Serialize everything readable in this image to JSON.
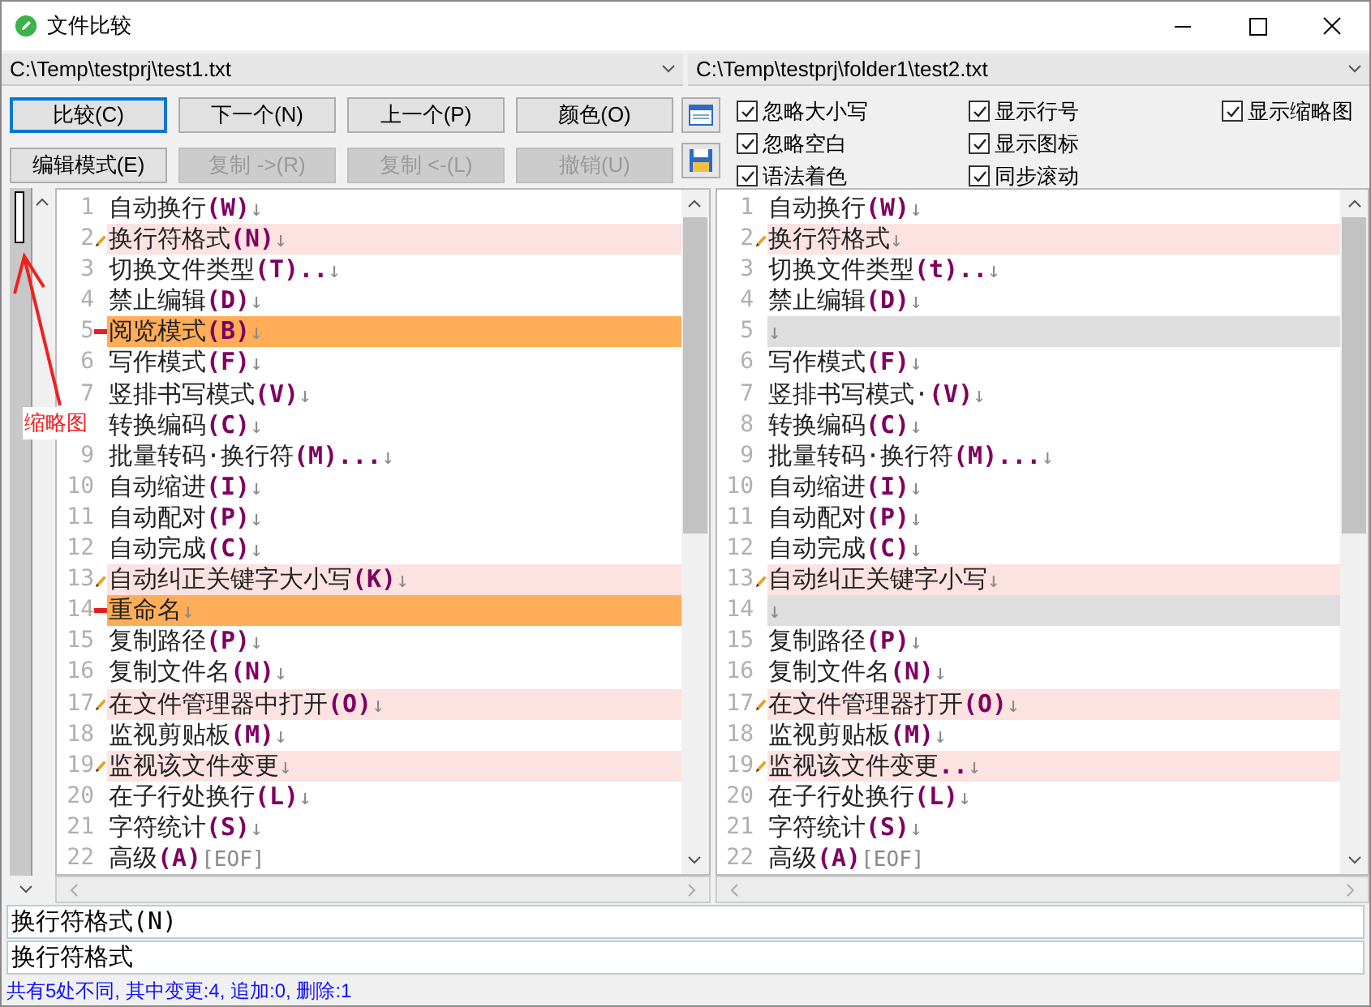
{
  "window": {
    "title": "文件比较"
  },
  "paths": [
    "C:\\Temp\\testprj\\test1.txt",
    "C:\\Temp\\testprj\\folder1\\test2.txt"
  ],
  "buttons": [
    {
      "label": "比较(C)",
      "disabled": false,
      "focused": true
    },
    {
      "label": "下一个(N)",
      "disabled": false,
      "focused": false
    },
    {
      "label": "上一个(P)",
      "disabled": false,
      "focused": false
    },
    {
      "label": "颜色(O)",
      "disabled": false,
      "focused": false
    },
    {
      "label": "编辑模式(E)",
      "disabled": false,
      "focused": false
    },
    {
      "label": "复制 ->(R)",
      "disabled": true,
      "focused": false
    },
    {
      "label": "复制 <-(L)",
      "disabled": true,
      "focused": false
    },
    {
      "label": "撤销(U)",
      "disabled": true,
      "focused": false
    }
  ],
  "options": [
    {
      "label": "忽略大小写",
      "checked": true
    },
    {
      "label": "忽略空白",
      "checked": true
    },
    {
      "label": "语法着色",
      "checked": true
    },
    {
      "label": "显示行号",
      "checked": true
    },
    {
      "label": "显示图标",
      "checked": true
    },
    {
      "label": "同步滚动",
      "checked": true
    },
    {
      "label": "显示缩略图",
      "checked": true
    }
  ],
  "annotation": {
    "label": "缩略图"
  },
  "panes": [
    {
      "lines": [
        {
          "number": "1",
          "kind": "same",
          "segments": [
            {
              "kind": "text",
              "text": "自动换行"
            },
            {
              "kind": "key",
              "text": "(W)"
            },
            {
              "kind": "mark",
              "text": "↓"
            }
          ]
        },
        {
          "number": "2",
          "kind": "changed",
          "segments": [
            {
              "kind": "text",
              "text": "换行符格式"
            },
            {
              "kind": "key",
              "text": "(N)"
            },
            {
              "kind": "mark",
              "text": "↓"
            }
          ]
        },
        {
          "number": "3",
          "kind": "same",
          "segments": [
            {
              "kind": "text",
              "text": "切换文件类型"
            },
            {
              "kind": "key",
              "text": "(T).."
            },
            {
              "kind": "mark",
              "text": "↓"
            }
          ]
        },
        {
          "number": "4",
          "kind": "same",
          "segments": [
            {
              "kind": "text",
              "text": "禁止编辑"
            },
            {
              "kind": "key",
              "text": "(D)"
            },
            {
              "kind": "mark",
              "text": "↓"
            }
          ]
        },
        {
          "number": "5",
          "kind": "removed",
          "segments": [
            {
              "kind": "text",
              "text": "阅览模式"
            },
            {
              "kind": "key",
              "text": "(B)"
            },
            {
              "kind": "mark",
              "text": "↓"
            }
          ]
        },
        {
          "number": "6",
          "kind": "same",
          "segments": [
            {
              "kind": "text",
              "text": "写作模式"
            },
            {
              "kind": "key",
              "text": "(F)"
            },
            {
              "kind": "mark",
              "text": "↓"
            }
          ]
        },
        {
          "number": "7",
          "kind": "same",
          "segments": [
            {
              "kind": "text",
              "text": "竖排书写模式"
            },
            {
              "kind": "key",
              "text": "(V)"
            },
            {
              "kind": "mark",
              "text": "↓"
            }
          ]
        },
        {
          "kind": "same",
          "segments": [
            {
              "kind": "text",
              "text": "转换编码"
            },
            {
              "kind": "key",
              "text": "(C)"
            },
            {
              "kind": "mark",
              "text": "↓"
            }
          ]
        },
        {
          "number": "9",
          "kind": "same",
          "segments": [
            {
              "kind": "text",
              "text": "批量转码·换行符"
            },
            {
              "kind": "key",
              "text": "(M)..."
            },
            {
              "kind": "mark",
              "text": "↓"
            }
          ]
        },
        {
          "number": "10",
          "kind": "same",
          "segments": [
            {
              "kind": "text",
              "text": "自动缩进"
            },
            {
              "kind": "key",
              "text": "(I)"
            },
            {
              "kind": "mark",
              "text": "↓"
            }
          ]
        },
        {
          "number": "11",
          "kind": "same",
          "segments": [
            {
              "kind": "text",
              "text": "自动配对"
            },
            {
              "kind": "key",
              "text": "(P)"
            },
            {
              "kind": "mark",
              "text": "↓"
            }
          ]
        },
        {
          "number": "12",
          "kind": "same",
          "segments": [
            {
              "kind": "text",
              "text": "自动完成"
            },
            {
              "kind": "key",
              "text": "(C)"
            },
            {
              "kind": "mark",
              "text": "↓"
            }
          ]
        },
        {
          "number": "13",
          "kind": "changed",
          "segments": [
            {
              "kind": "text",
              "text": "自动纠正关键字大小写"
            },
            {
              "kind": "key",
              "text": "(K)"
            },
            {
              "kind": "mark",
              "text": "↓"
            }
          ]
        },
        {
          "number": "14",
          "kind": "removed",
          "segments": [
            {
              "kind": "text",
              "text": "重命名"
            },
            {
              "kind": "mark",
              "text": "↓"
            }
          ]
        },
        {
          "number": "15",
          "kind": "same",
          "segments": [
            {
              "kind": "text",
              "text": "复制路径"
            },
            {
              "kind": "key",
              "text": "(P)"
            },
            {
              "kind": "mark",
              "text": "↓"
            }
          ]
        },
        {
          "number": "16",
          "kind": "same",
          "segments": [
            {
              "kind": "text",
              "text": "复制文件名"
            },
            {
              "kind": "key",
              "text": "(N)"
            },
            {
              "kind": "mark",
              "text": "↓"
            }
          ]
        },
        {
          "number": "17",
          "kind": "changed",
          "segments": [
            {
              "kind": "text",
              "text": "在文件管理器中打开"
            },
            {
              "kind": "key",
              "text": "(O)"
            },
            {
              "kind": "mark",
              "text": "↓"
            }
          ]
        },
        {
          "number": "18",
          "kind": "same",
          "segments": [
            {
              "kind": "text",
              "text": "监视剪贴板"
            },
            {
              "kind": "key",
              "text": "(M)"
            },
            {
              "kind": "mark",
              "text": "↓"
            }
          ]
        },
        {
          "number": "19",
          "kind": "changed",
          "segments": [
            {
              "kind": "text",
              "text": "监视该文件变更"
            },
            {
              "kind": "mark",
              "text": "↓"
            }
          ]
        },
        {
          "number": "20",
          "kind": "same",
          "segments": [
            {
              "kind": "text",
              "text": "在子行处换行"
            },
            {
              "kind": "key",
              "text": "(L)"
            },
            {
              "kind": "mark",
              "text": "↓"
            }
          ]
        },
        {
          "number": "21",
          "kind": "same",
          "segments": [
            {
              "kind": "text",
              "text": "字符统计"
            },
            {
              "kind": "key",
              "text": "(S)"
            },
            {
              "kind": "mark",
              "text": "↓"
            }
          ]
        },
        {
          "number": "22",
          "kind": "same",
          "segments": [
            {
              "kind": "text",
              "text": "高级"
            },
            {
              "kind": "key",
              "text": "(A)"
            },
            {
              "kind": "mark",
              "text": "[EOF]"
            }
          ]
        }
      ]
    },
    {
      "lines": [
        {
          "number": "1",
          "kind": "same",
          "segments": [
            {
              "kind": "text",
              "text": "自动换行"
            },
            {
              "kind": "key",
              "text": "(W)"
            },
            {
              "kind": "mark",
              "text": "↓"
            }
          ]
        },
        {
          "number": "2",
          "kind": "changed",
          "segments": [
            {
              "kind": "text",
              "text": "换行符格式"
            },
            {
              "kind": "mark",
              "text": "↓"
            }
          ]
        },
        {
          "number": "3",
          "kind": "same",
          "segments": [
            {
              "kind": "text",
              "text": "切换文件类型"
            },
            {
              "kind": "key",
              "text": "(t).."
            },
            {
              "kind": "mark",
              "text": "↓"
            }
          ]
        },
        {
          "number": "4",
          "kind": "same",
          "segments": [
            {
              "kind": "text",
              "text": "禁止编辑"
            },
            {
              "kind": "key",
              "text": "(D)"
            },
            {
              "kind": "mark",
              "text": "↓"
            }
          ]
        },
        {
          "number": "5",
          "kind": "empty",
          "segments": [
            {
              "kind": "mark",
              "text": "↓"
            }
          ]
        },
        {
          "number": "6",
          "kind": "same",
          "segments": [
            {
              "kind": "text",
              "text": "写作模式"
            },
            {
              "kind": "key",
              "text": "(F)"
            },
            {
              "kind": "mark",
              "text": "↓"
            }
          ]
        },
        {
          "number": "7",
          "kind": "same",
          "segments": [
            {
              "kind": "text",
              "text": "竖排书写模式·"
            },
            {
              "kind": "key",
              "text": "(V)"
            },
            {
              "kind": "mark",
              "text": "↓"
            }
          ]
        },
        {
          "number": "8",
          "kind": "same",
          "segments": [
            {
              "kind": "text",
              "text": "转换编码"
            },
            {
              "kind": "key",
              "text": "(C)"
            },
            {
              "kind": "mark",
              "text": "↓"
            }
          ]
        },
        {
          "number": "9",
          "kind": "same",
          "segments": [
            {
              "kind": "text",
              "text": "批量转码·换行符"
            },
            {
              "kind": "key",
              "text": "(M)..."
            },
            {
              "kind": "mark",
              "text": "↓"
            }
          ]
        },
        {
          "number": "10",
          "kind": "same",
          "segments": [
            {
              "kind": "text",
              "text": "自动缩进"
            },
            {
              "kind": "key",
              "text": "(I)"
            },
            {
              "kind": "mark",
              "text": "↓"
            }
          ]
        },
        {
          "number": "11",
          "kind": "same",
          "segments": [
            {
              "kind": "text",
              "text": "自动配对"
            },
            {
              "kind": "key",
              "text": "(P)"
            },
            {
              "kind": "mark",
              "text": "↓"
            }
          ]
        },
        {
          "number": "12",
          "kind": "same",
          "segments": [
            {
              "kind": "text",
              "text": "自动完成"
            },
            {
              "kind": "key",
              "text": "(C)"
            },
            {
              "kind": "mark",
              "text": "↓"
            }
          ]
        },
        {
          "number": "13",
          "kind": "changed",
          "segments": [
            {
              "kind": "text",
              "text": "自动纠正关键字小写"
            },
            {
              "kind": "mark",
              "text": "↓"
            }
          ]
        },
        {
          "number": "14",
          "kind": "empty",
          "segments": [
            {
              "kind": "mark",
              "text": "↓"
            }
          ]
        },
        {
          "number": "15",
          "kind": "same",
          "segments": [
            {
              "kind": "text",
              "text": "复制路径"
            },
            {
              "kind": "key",
              "text": "(P)"
            },
            {
              "kind": "mark",
              "text": "↓"
            }
          ]
        },
        {
          "number": "16",
          "kind": "same",
          "segments": [
            {
              "kind": "text",
              "text": "复制文件名"
            },
            {
              "kind": "key",
              "text": "(N)"
            },
            {
              "kind": "mark",
              "text": "↓"
            }
          ]
        },
        {
          "number": "17",
          "kind": "changed",
          "segments": [
            {
              "kind": "text",
              "text": "在文件管理器打开"
            },
            {
              "kind": "key",
              "text": "(O)"
            },
            {
              "kind": "mark",
              "text": "↓"
            }
          ]
        },
        {
          "number": "18",
          "kind": "same",
          "segments": [
            {
              "kind": "text",
              "text": "监视剪贴板"
            },
            {
              "kind": "key",
              "text": "(M)"
            },
            {
              "kind": "mark",
              "text": "↓"
            }
          ]
        },
        {
          "number": "19",
          "kind": "changed",
          "segments": [
            {
              "kind": "text",
              "text": "监视该文件变更"
            },
            {
              "kind": "key",
              "text": ".."
            },
            {
              "kind": "mark",
              "text": "↓"
            }
          ]
        },
        {
          "number": "20",
          "kind": "same",
          "segments": [
            {
              "kind": "text",
              "text": "在子行处换行"
            },
            {
              "kind": "key",
              "text": "(L)"
            },
            {
              "kind": "mark",
              "text": "↓"
            }
          ]
        },
        {
          "number": "21",
          "kind": "same",
          "segments": [
            {
              "kind": "text",
              "text": "字符统计"
            },
            {
              "kind": "key",
              "text": "(S)"
            },
            {
              "kind": "mark",
              "text": "↓"
            }
          ]
        },
        {
          "number": "22",
          "kind": "same",
          "segments": [
            {
              "kind": "text",
              "text": "高级"
            },
            {
              "kind": "key",
              "text": "(A)"
            },
            {
              "kind": "mark",
              "text": "[EOF]"
            }
          ]
        }
      ]
    }
  ],
  "detail_lines": [
    "换行符格式(N)",
    "换行符格式"
  ],
  "status_bar": "共有5处不同, 其中变更:4, 追加:0, 删除:1"
}
